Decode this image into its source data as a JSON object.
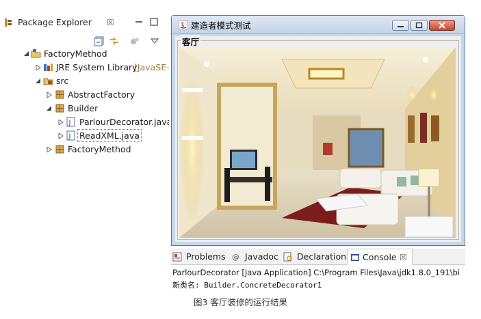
{
  "package_explorer": {
    "tab_label": "Package Explorer",
    "close_glyph": "☒",
    "tree": [
      {
        "label": "FactoryMethod",
        "icon": "project-icon",
        "expanded": true
      },
      {
        "label": "JRE System Library",
        "suffix": "[JavaSE-",
        "icon": "library-icon",
        "expanded": false
      },
      {
        "label": "src",
        "icon": "source-folder-icon",
        "expanded": true
      },
      {
        "label": "AbstractFactory",
        "icon": "package-icon",
        "expanded": false
      },
      {
        "label": "Builder",
        "icon": "package-icon",
        "expanded": true
      },
      {
        "label": "ParlourDecorator.java",
        "icon": "java-file-icon",
        "expanded": false
      },
      {
        "label": "ReadXML.java",
        "icon": "java-file-icon",
        "expanded": false
      },
      {
        "label": "FactoryMethod",
        "icon": "package-icon",
        "expanded": false
      }
    ]
  },
  "app_window": {
    "title": "建造者模式测试",
    "group_label": "客厅",
    "image_subject": "living room interior"
  },
  "bottom_views": {
    "tabs": [
      {
        "label": "Problems",
        "icon": "problems-icon",
        "active": false
      },
      {
        "label": "Javadoc",
        "icon": "javadoc-icon",
        "active": false
      },
      {
        "label": "Declaration",
        "icon": "declaration-icon",
        "active": false
      },
      {
        "label": "Console",
        "icon": "console-icon",
        "active": true
      }
    ],
    "console_close": "☒",
    "console_header": "ParlourDecorator [Java Application] C:\\Program Files\\Java\\jdk1.8.0_191\\bi",
    "console_output": "新类名: Builder.ConcreteDecorator1"
  },
  "caption": "图3 客厅装修的运行结果",
  "colors": {
    "title_bar": "#c3d3e7",
    "close_button": "#c4452c",
    "wall_warm": "#e8dcc0"
  }
}
